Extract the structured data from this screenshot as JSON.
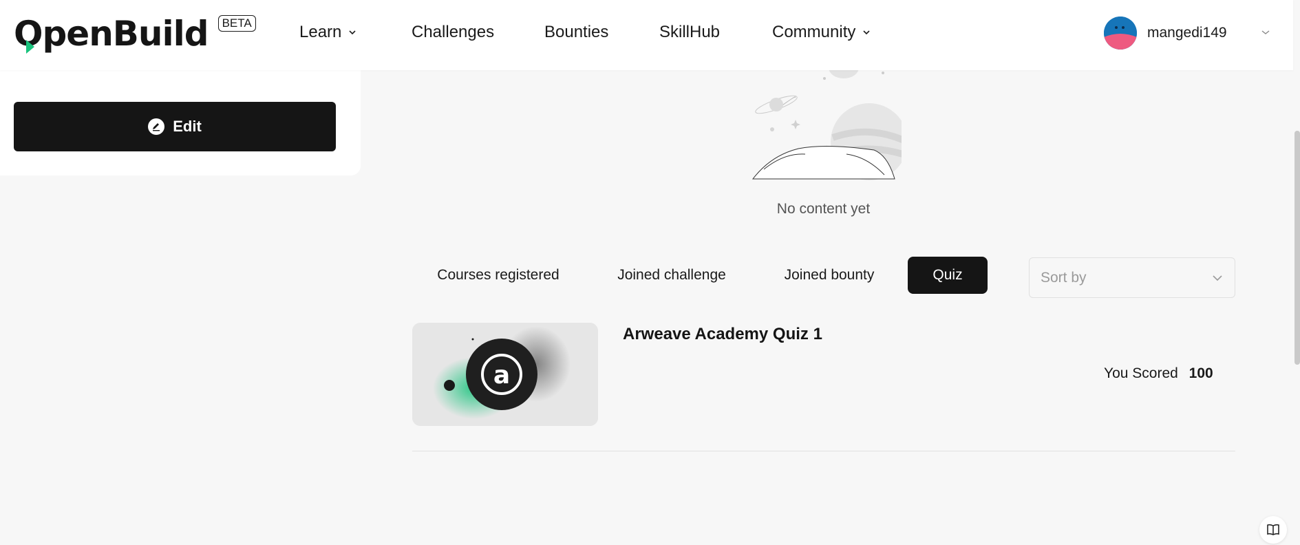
{
  "header": {
    "logo_text": "OpenBuild",
    "beta_label": "BETA",
    "nav": [
      {
        "label": "Learn",
        "has_dropdown": true
      },
      {
        "label": "Challenges",
        "has_dropdown": false
      },
      {
        "label": "Bounties",
        "has_dropdown": false
      },
      {
        "label": "SkillHub",
        "has_dropdown": false
      },
      {
        "label": "Community",
        "has_dropdown": true
      }
    ],
    "user": {
      "name": "mangedi149"
    }
  },
  "profile": {
    "edit_label": "Edit"
  },
  "empty_state": {
    "text": "No content yet"
  },
  "tabs": [
    {
      "label": "Courses registered",
      "active": false
    },
    {
      "label": "Joined challenge",
      "active": false
    },
    {
      "label": "Joined bounty",
      "active": false
    },
    {
      "label": "Quiz",
      "active": true
    }
  ],
  "sort": {
    "placeholder": "Sort by"
  },
  "quizzes": [
    {
      "title": "Arweave Academy Quiz 1",
      "score_label": "You Scored",
      "score": "100",
      "thumbnail_icon": "arweave-logo-icon"
    }
  ],
  "colors": {
    "accent_green": "#19c37d",
    "dark": "#151515",
    "background": "#f7f7f7"
  }
}
